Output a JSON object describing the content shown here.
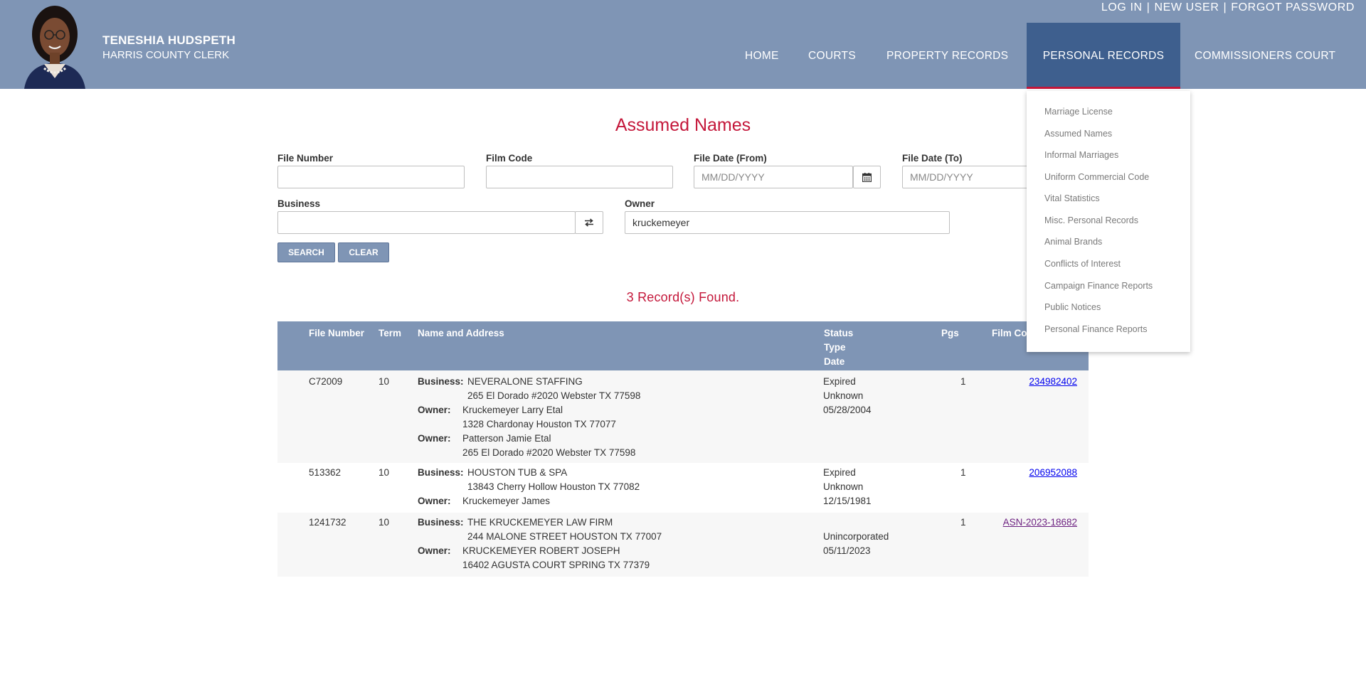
{
  "header": {
    "name": "TENESHIA HUDSPETH",
    "title": "HARRIS COUNTY CLERK",
    "account_links": [
      "LOG IN",
      "NEW USER",
      "FORGOT PASSWORD"
    ],
    "separator": "|"
  },
  "nav": {
    "items": [
      "HOME",
      "COURTS",
      "PROPERTY RECORDS",
      "PERSONAL RECORDS",
      "COMMISSIONERS COURT"
    ],
    "active": "PERSONAL RECORDS",
    "dropdown": [
      "Marriage License",
      "Assumed Names",
      "Informal Marriages",
      "Uniform Commercial Code",
      "Vital Statistics",
      "Misc. Personal Records",
      "Animal Brands",
      "Conflicts of Interest",
      "Campaign Finance Reports",
      "Public Notices",
      "Personal Finance Reports"
    ]
  },
  "form": {
    "title": "Assumed Names",
    "file_number": {
      "label": "File Number",
      "value": ""
    },
    "film_code": {
      "label": "Film Code",
      "value": ""
    },
    "file_date_from": {
      "label": "File Date (From)",
      "placeholder": "MM/DD/YYYY"
    },
    "file_date_to": {
      "label": "File Date (To)",
      "placeholder": "MM/DD/YYYY"
    },
    "business": {
      "label": "Business",
      "value": ""
    },
    "owner": {
      "label": "Owner",
      "value": "kruckemeyer"
    },
    "search_label": "SEARCH",
    "clear_label": "CLEAR"
  },
  "results": {
    "summary": "3 Record(s) Found.",
    "columns": {
      "file_number": "File Number",
      "term": "Term",
      "name_address": "Name and Address",
      "status": "Status",
      "type": "Type",
      "date": "Date",
      "pgs": "Pgs",
      "film_code": "Film Code"
    },
    "business_label": "Business:",
    "owner_label": "Owner:",
    "rows": [
      {
        "file_number": "C72009",
        "term": "10",
        "business": "NEVERALONE STAFFING",
        "business_addr": "265 El Dorado #2020 Webster TX 77598",
        "owners": [
          {
            "name": "Kruckemeyer Larry Etal",
            "addr": "1328 Chardonay Houston TX 77077"
          },
          {
            "name": "Patterson Jamie Etal",
            "addr": "265 El Dorado #2020 Webster TX 77598"
          }
        ],
        "status": "Expired",
        "type": "Unknown",
        "date": "05/28/2004",
        "pgs": "1",
        "film_code": "234982402"
      },
      {
        "file_number": "513362",
        "term": "10",
        "business": "HOUSTON TUB & SPA",
        "business_addr": "13843 Cherry Hollow Houston TX 77082",
        "owners": [
          {
            "name": "Kruckemeyer James",
            "addr": ""
          }
        ],
        "status": "Expired",
        "type": "Unknown",
        "date": "12/15/1981",
        "pgs": "1",
        "film_code": "206952088"
      },
      {
        "file_number": "1241732",
        "term": "10",
        "business": "THE KRUCKEMEYER LAW FIRM",
        "business_addr": "244 MALONE STREET HOUSTON TX 77007",
        "owners": [
          {
            "name": "KRUCKEMEYER ROBERT JOSEPH",
            "addr": "16402 AGUSTA COURT SPRING TX 77379"
          }
        ],
        "status": "",
        "type": "Unincorporated",
        "date": "05/11/2023",
        "pgs": "1",
        "film_code": "ASN-2023-18682"
      }
    ]
  }
}
